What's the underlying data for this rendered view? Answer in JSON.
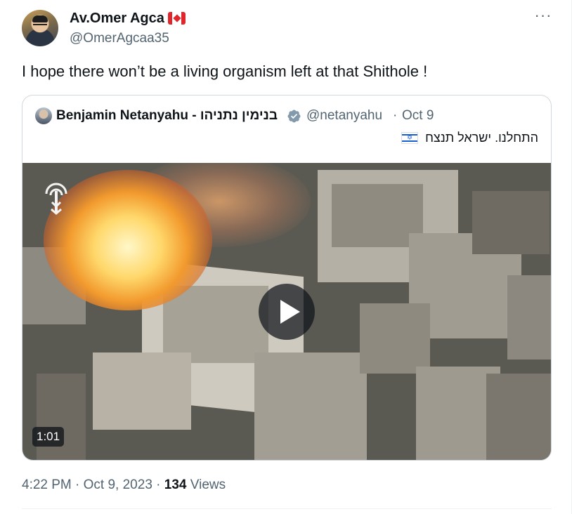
{
  "author": {
    "display_name": "Av.Omer Agca",
    "flag_icon": "canada-flag-icon",
    "handle": "@OmerAgcaa35"
  },
  "tweet": {
    "text": "I hope there won’t be a living organism left at that Shithole !"
  },
  "more_icon": "more-horizontal-icon",
  "quoted": {
    "display_name": "Benjamin Netanyahu - בנימין נתניהו",
    "verified_icon": "verified-badge-icon",
    "verified_color": "#829aab",
    "handle": "@netanyahu",
    "separator": "·",
    "date": "Oct 9",
    "text": "התחלנו. ישראל תנצח",
    "flag_icon": "israel-flag-icon",
    "media": {
      "type": "video",
      "duration": "1:01",
      "play_icon": "play-icon",
      "watermark_icon": "idf-logo-icon"
    }
  },
  "meta": {
    "time": "4:22 PM",
    "separator": "·",
    "date": "Oct 9, 2023",
    "views_count": "134",
    "views_label": "Views"
  },
  "colors": {
    "text_primary": "#0f1419",
    "text_secondary": "#536471",
    "border": "#cfd9de"
  }
}
